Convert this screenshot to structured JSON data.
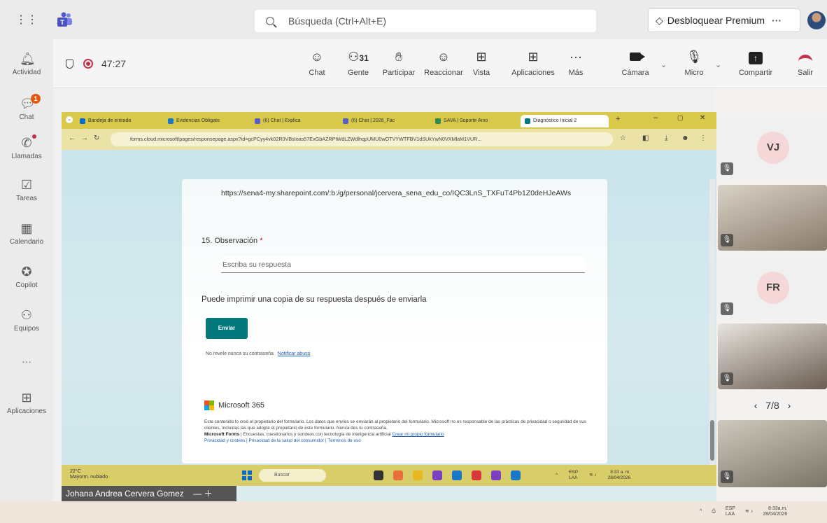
{
  "search": {
    "placeholder": "Búsqueda (Ctrl+Alt+E)"
  },
  "premium": {
    "label": "Desbloquear Premium",
    "more": "···"
  },
  "rail": [
    {
      "label": "Actividad",
      "icon": "bell-icon"
    },
    {
      "label": "Chat",
      "icon": "chat-icon",
      "badge": "1"
    },
    {
      "label": "Llamadas",
      "icon": "phone-icon"
    },
    {
      "label": "Tareas",
      "icon": "tasks-icon"
    },
    {
      "label": "Calendario",
      "icon": "calendar-icon"
    },
    {
      "label": "Copilot",
      "icon": "copilot-icon"
    },
    {
      "label": "Equipos",
      "icon": "teams-icon"
    },
    {
      "label": "···",
      "icon": "more-icon"
    },
    {
      "label": "Aplicaciones",
      "icon": "apps-icon"
    }
  ],
  "meeting": {
    "timer": "47:27",
    "people_count": "31",
    "buttons": {
      "chat": "Chat",
      "people": "Gente",
      "raise": "Participar",
      "react": "Reaccionar",
      "view": "Vista",
      "apps": "Aplicaciones",
      "more": "Más",
      "camera": "Cámara",
      "mic": "Micro",
      "share": "Compartir",
      "leave": "Salir"
    }
  },
  "browser": {
    "tabs": [
      "Bandeja de entrada",
      "Evidencias Obligato",
      "(6) Chat | Explica",
      "(6) Chat | 2026_Fac",
      "SAVA | Soporte Amo",
      "Diagnóstico Inicial 2"
    ],
    "url": "forms.cloud.microsoft/pages/responsepage.aspx?id=gcPCyy4vk02R0VBsIoas57ExGbAZRPtWdLZWdlhqpUMU0wOTVYWTFBV1dSUkYwN0VXMlaM1VUR..."
  },
  "form": {
    "prev_answer": "https://sena4-my.sharepoint.com/:b:/g/personal/jcervera_sena_edu_co/IQC3LnS_TXFuT4Pb1Z0deHJeAWs",
    "question_number": "15.",
    "question": "Observación",
    "required_mark": "*",
    "answer_placeholder": "Escriba su respuesta",
    "print_note": "Puede imprimir una copia de su respuesta después de enviarla",
    "submit": "Enviar",
    "password_note": "No revele nunca su contraseña.",
    "report_link": "Notificar abuso",
    "brand": "Microsoft 365",
    "disclaimer1": "Este contenido lo creó el propietario del formulario. Los datos que envíes se enviarán al propietario del formulario. Microsoft no es responsable de las prácticas de privacidad o seguridad de sus clientes, incluidas las que adopte el propietario de este formulario. Nunca des tu contraseña.",
    "disclaimer2_bold": "Microsoft Forms",
    "disclaimer2": "| Encuestas, cuestionarios y sondeos con tecnología de inteligencia artificial",
    "disclaimer2_link": "Crear mi propio formulario",
    "disclaimer3": "Privacidad y cookies | Privacidad de la salud del consumidor | Términos de uso"
  },
  "inner_taskbar": {
    "temp": "22°C",
    "weather": "Mayorm. nublado",
    "search": "Buscar",
    "lang": "ESP",
    "lang2": "LAA",
    "time": "8:33 a. m.",
    "date": "28/04/2026"
  },
  "presenter_name": "Johana Andrea Cervera Gomez",
  "roster": {
    "tile1_initials": "VJ",
    "tile3_initials": "FR",
    "pager": "7/8"
  },
  "outer_taskbar": {
    "lang": "ESP",
    "lang2": "LAA",
    "time": "8:33a.m.",
    "date": "28/04/2026"
  },
  "colors": {
    "accent": "#03787c",
    "brand": "#5b5fc7",
    "alert": "#c4314b"
  }
}
